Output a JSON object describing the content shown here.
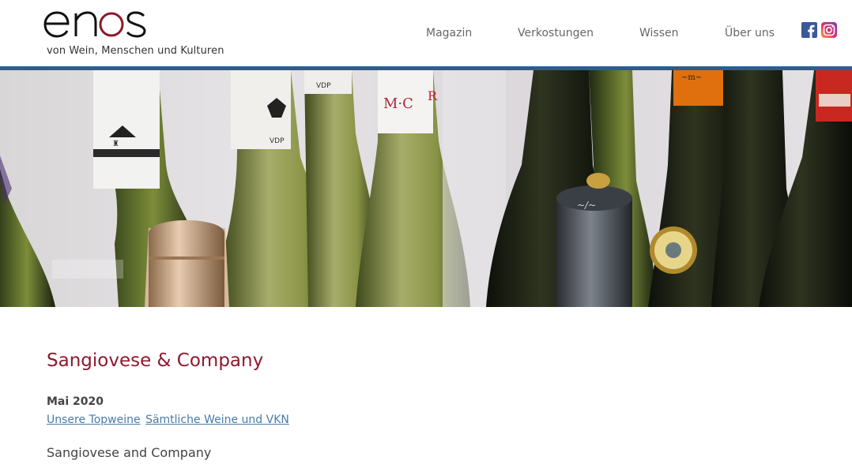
{
  "header": {
    "logo_text": "enos",
    "tagline": "von Wein, Menschen und Kulturen",
    "nav": [
      {
        "label": "Magazin"
      },
      {
        "label": "Verkostungen"
      },
      {
        "label": "Wissen"
      },
      {
        "label": "Über uns"
      }
    ],
    "social": [
      {
        "icon": "facebook-icon",
        "color": "#3b5998"
      },
      {
        "icon": "instagram-icon",
        "color": "#c13584"
      }
    ],
    "accent_bar_color": "#2d5d8c"
  },
  "hero": {
    "image": "wine-bottles-photo",
    "bottle_labels": [
      "VDP",
      "VDP",
      "M·C"
    ]
  },
  "main": {
    "title": "Sangiovese & Company",
    "title_color": "#8c1a2e",
    "date": "Mai 2020",
    "links": [
      {
        "label": "Unsere Topweine"
      },
      {
        "label": "Sämtliche Weine und VKN"
      }
    ],
    "subtitle": "Sangiovese and Company"
  }
}
